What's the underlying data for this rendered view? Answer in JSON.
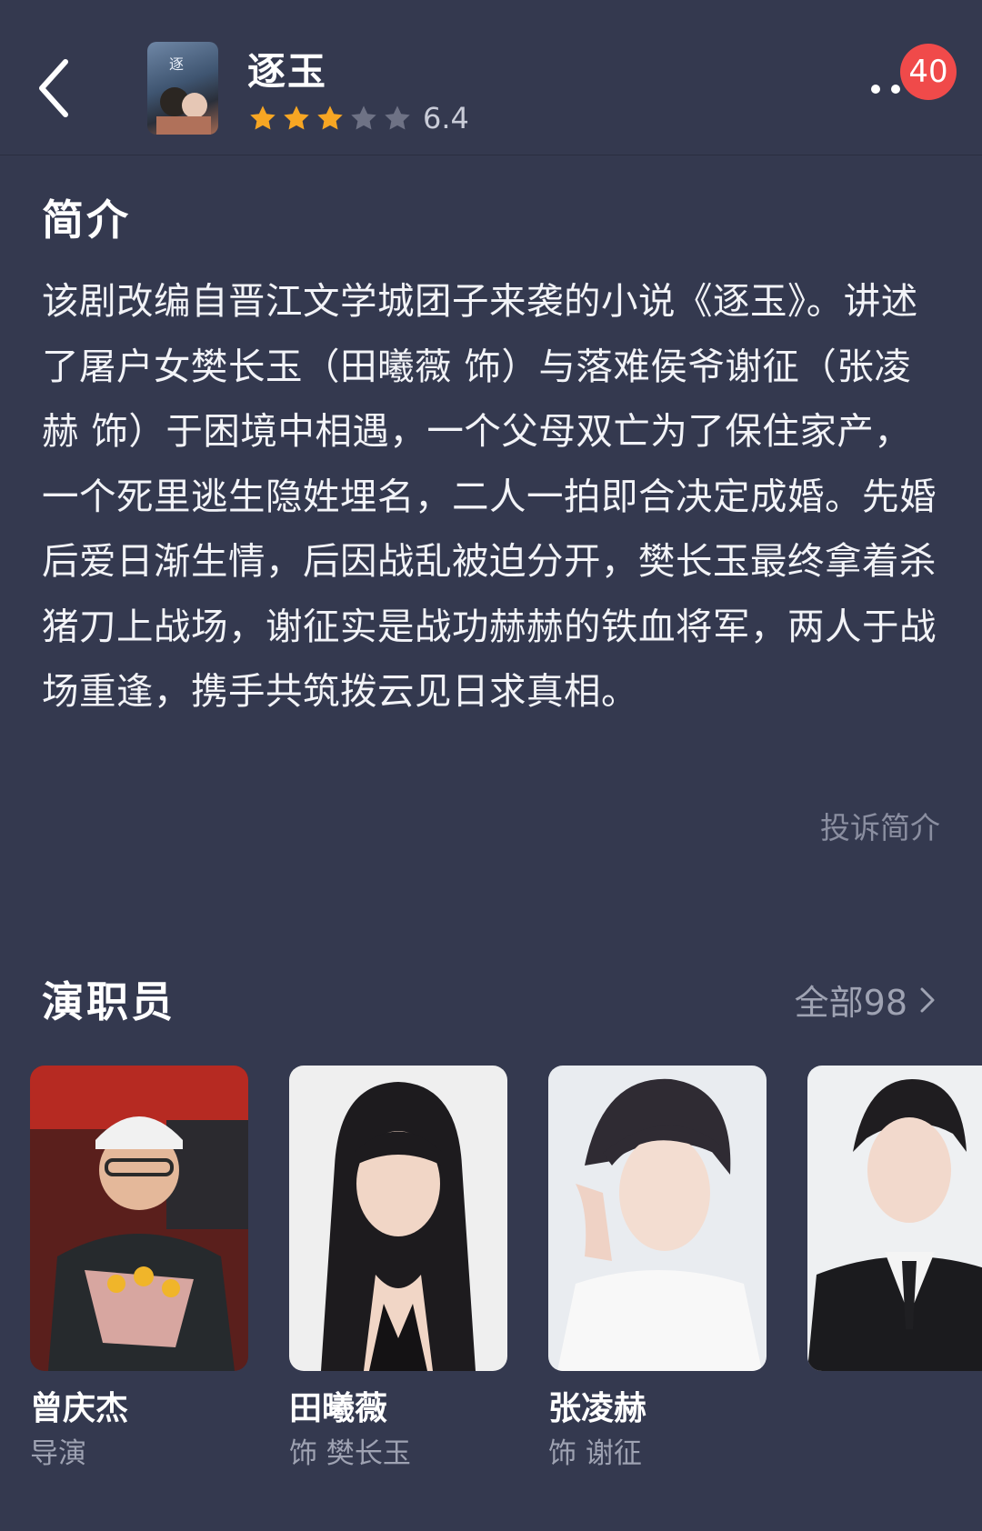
{
  "header": {
    "title": "逐玉",
    "rating_score": "6.4",
    "rating_stars": 3,
    "stars_max": 5,
    "notification_count": "40"
  },
  "intro": {
    "heading": "简介",
    "text": "该剧改编自晋江文学城团子来袭的小说《逐玉》。讲述了屠户女樊长玉（田曦薇 饰）与落难侯爷谢征（张凌赫 饰）于困境中相遇，一个父母双亡为了保住家产，一个死里逃生隐姓埋名，二人一拍即合决定成婚。先婚后爱日渐生情，后因战乱被迫分开，樊长玉最终拿着杀猪刀上战场，谢征实是战功赫赫的铁血将军，两人于战场重逢，携手共筑拨云见日求真相。",
    "complain_label": "投诉简介"
  },
  "cast": {
    "heading": "演职员",
    "all_label": "全部98",
    "members": [
      {
        "name": "曾庆杰",
        "role": "导演"
      },
      {
        "name": "田曦薇",
        "role": "饰 樊长玉"
      },
      {
        "name": "张凌赫",
        "role": "饰 谢征"
      },
      {
        "name": "",
        "role": ""
      }
    ]
  },
  "colors": {
    "background": "#34394f",
    "star_filled": "#f7a623",
    "star_empty": "#6e7285",
    "badge": "#f04a4a"
  }
}
